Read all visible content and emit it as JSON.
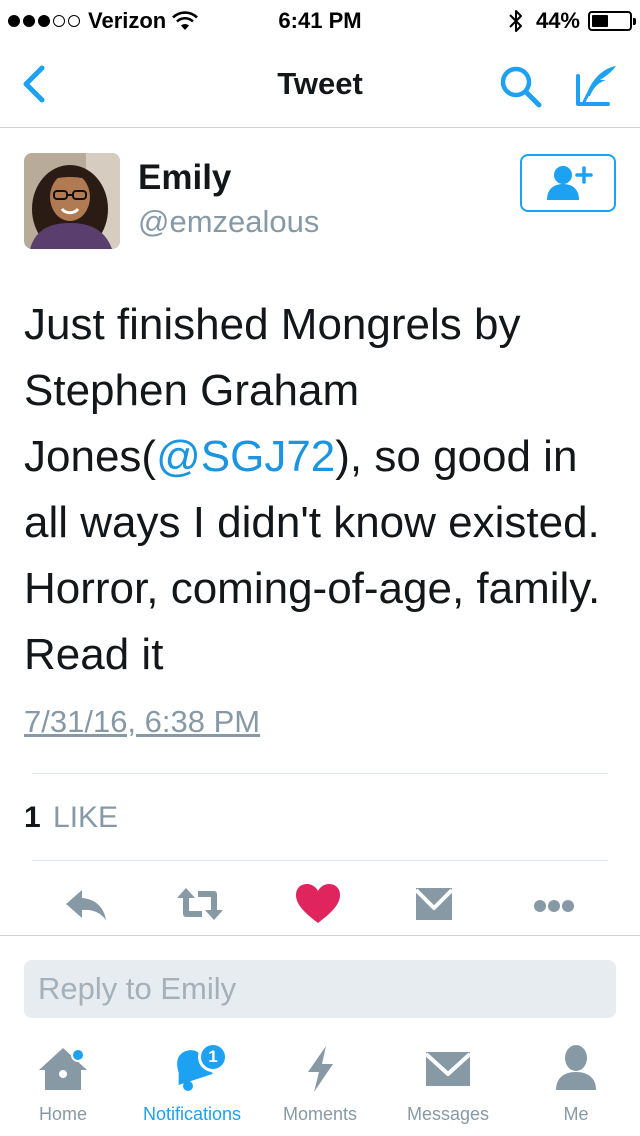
{
  "status_bar": {
    "carrier": "Verizon",
    "time": "6:41 PM",
    "battery": "44%",
    "battery_level": 0.44,
    "signal_bars": 3
  },
  "nav": {
    "title": "Tweet",
    "icons": [
      "back-icon",
      "search-icon",
      "compose-icon"
    ]
  },
  "tweet": {
    "user": {
      "name": "Emily",
      "handle": "@emzealous"
    },
    "text_part1": "Just finished Mongrels by Stephen Graham Jones(",
    "mention": "@SGJ72",
    "text_part2": "), so good in all ways I didn't know existed. Horror, coming-of-age, family. Read it",
    "timestamp": "7/31/16, 6:38 PM",
    "likes_count": "1",
    "likes_label": "LIKE"
  },
  "actions": [
    "reply-icon",
    "retweet-icon",
    "like-icon",
    "direct-message-icon",
    "more-icon"
  ],
  "reply": {
    "placeholder": "Reply to Emily"
  },
  "tabs": [
    {
      "label": "Home",
      "icon": "home-icon"
    },
    {
      "label": "Notifications",
      "icon": "bell-icon",
      "badge": "1"
    },
    {
      "label": "Moments",
      "icon": "lightning-icon"
    },
    {
      "label": "Messages",
      "icon": "envelope-icon"
    },
    {
      "label": "Me",
      "icon": "person-icon"
    }
  ],
  "colors": {
    "accent": "#1da1f2",
    "link": "#1b95e0",
    "like": "#e0245e",
    "text": "#14171a",
    "secondary": "#8899a6"
  }
}
